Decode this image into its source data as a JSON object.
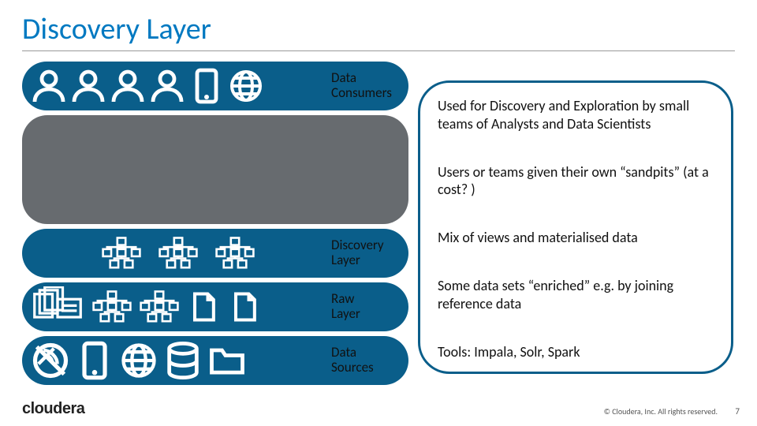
{
  "title": "Discovery Layer",
  "layers": {
    "consumers": {
      "label_a": "Data",
      "label_b": "Consumers"
    },
    "discovery": {
      "label_a": "Discovery",
      "label_b": "Layer"
    },
    "raw": {
      "label_a": "Raw",
      "label_b": "Layer"
    },
    "sources": {
      "label_a": "Data",
      "label_b": "Sources"
    }
  },
  "callout": {
    "p1": "Used for Discovery and Exploration by small teams of Analysts and Data Scientists",
    "p2": "Users or teams given their own “sandpits” (at a cost? )",
    "p3": "Mix of views and materialised data",
    "p4": "Some data sets “enriched” e.g. by joining reference data",
    "p5": "Tools: Impala, Solr, Spark"
  },
  "footer": {
    "logo": "cloudera",
    "copyright": "© Cloudera, Inc. All rights reserved.",
    "page": "7"
  }
}
